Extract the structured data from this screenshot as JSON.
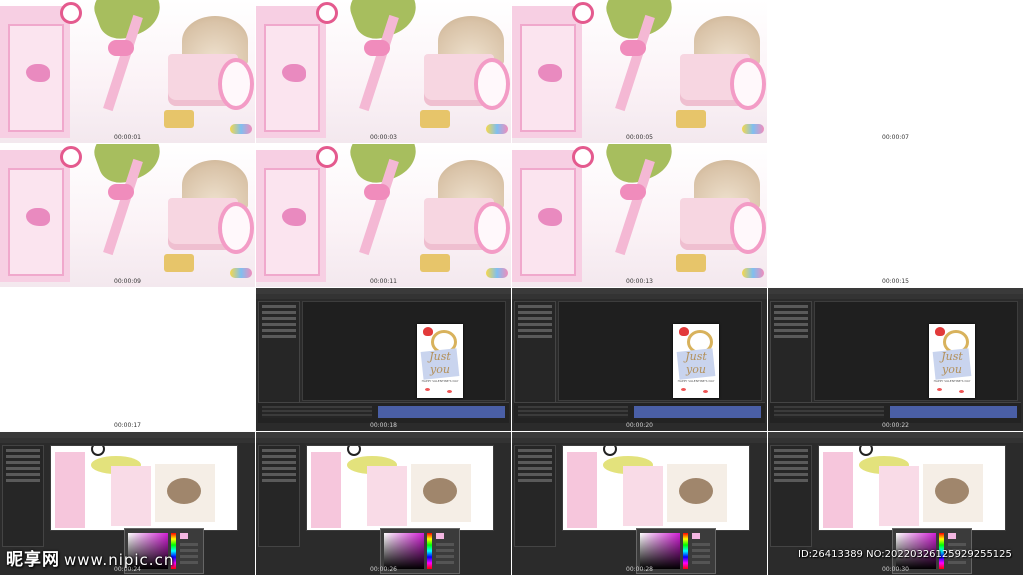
{
  "frames": [
    {
      "type": "pink",
      "timestamp": "00:00:01"
    },
    {
      "type": "pink",
      "timestamp": "00:00:03"
    },
    {
      "type": "pink",
      "timestamp": "00:00:05"
    },
    {
      "type": "blank",
      "timestamp": "00:00:07"
    },
    {
      "type": "pink",
      "timestamp": "00:00:09"
    },
    {
      "type": "pink",
      "timestamp": "00:00:11"
    },
    {
      "type": "pink",
      "timestamp": "00:00:13"
    },
    {
      "type": "blank",
      "timestamp": "00:00:15"
    },
    {
      "type": "blank",
      "timestamp": "00:00:17"
    },
    {
      "type": "editor-card",
      "timestamp": "00:00:18"
    },
    {
      "type": "editor-card",
      "timestamp": "00:00:20"
    },
    {
      "type": "editor-card",
      "timestamp": "00:00:22"
    },
    {
      "type": "editor-pink",
      "timestamp": "00:00:24"
    },
    {
      "type": "editor-pink",
      "timestamp": "00:00:26"
    },
    {
      "type": "editor-pink",
      "timestamp": "00:00:28"
    },
    {
      "type": "editor-pink",
      "timestamp": "00:00:30"
    }
  ],
  "card": {
    "script": "Just you",
    "subtitle": "HAPPY VALENTINE'S DAY"
  },
  "watermark": {
    "brand": "昵享网",
    "url": "www.nipic.cn"
  },
  "id_line": "ID:26413389 NO:20220326125929255125",
  "colors": {
    "ae_bg": "#2b2b2b",
    "timeline_bar": "#4a5fa6",
    "pink": "#f7cfe3"
  }
}
